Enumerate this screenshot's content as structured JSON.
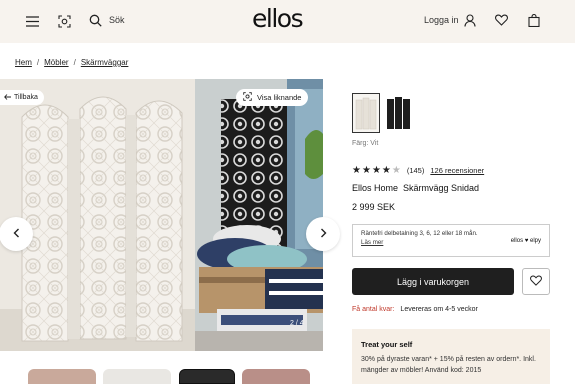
{
  "header": {
    "logo": "ellos",
    "search_label": "Sök",
    "login_label": "Logga in",
    "icons": [
      "menu-icon",
      "visual-search-icon",
      "search-icon",
      "user-icon",
      "heart-icon",
      "bag-icon"
    ]
  },
  "breadcrumb": {
    "items": [
      "Hem",
      "Möbler",
      "Skärmväggar"
    ],
    "separator": "/"
  },
  "gallery": {
    "back_label": "Tillbaka",
    "similar_label": "Visa liknande",
    "pager": "2 / 4"
  },
  "product": {
    "color_label": "Färg: Vit",
    "rating_count": "(145)",
    "reviews_link": "126 recensioner",
    "rating_value": 4,
    "brand": "Ellos Home",
    "name": "Skärmvägg Snidad",
    "price": "2 999 SEK",
    "finance_text": "Räntefri delbetalning 3, 6, 12 eller 18 mån.",
    "finance_link": "Läs mer",
    "pay_logos": "ellos ♥ elpy",
    "add_to_cart": "Lägg i varukorgen",
    "stock_left": "Få antal kvar:",
    "delivery": "Levereras om 4-5 veckor"
  },
  "promo": {
    "title": "Treat your self",
    "text": "30% på dyraste varan* + 15% på resten av ordern*. Inkl. mängder av möbler! Använd kod: 2015"
  },
  "colors": {
    "header_bg": "#f7f3ee",
    "button_bg": "#1f1f1f",
    "stock_red": "#c0392b",
    "promo_bg": "#f6efe6"
  }
}
